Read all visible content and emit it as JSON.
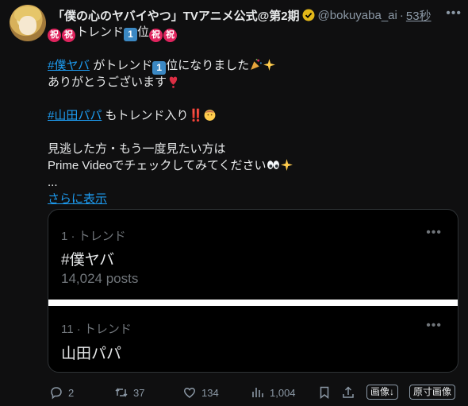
{
  "author": {
    "display_name": "「僕の心のヤバイやつ」TVアニメ公式@第2期",
    "handle": "@bokuyaba_ai",
    "separator": "·",
    "time": "53秒"
  },
  "tweet": {
    "line1_text": "トレンド",
    "line1_suffix": "位",
    "hashtag1": "#僕ヤバ",
    "line3_text": " がトレンド",
    "line3_suffix": "位になりました",
    "line4_text": "ありがとうございます",
    "hashtag2": "#山田パパ",
    "line6_text": " もトレンド入り‼️",
    "line8_text": "見逃した方・もう一度見たい方は",
    "line9_text": "Prime Videoでチェックしてみてください",
    "ellipsis": "...",
    "show_more": "さらに表示",
    "kanji_badge": "祝",
    "keycap": "1"
  },
  "trends": [
    {
      "meta": "1 · トレンド",
      "name": "#僕ヤバ",
      "posts": "14,024 posts"
    },
    {
      "meta": "11 · トレンド",
      "name": "山田パパ"
    }
  ],
  "more_glyph": "•••",
  "actions": {
    "replies": "2",
    "retweets": "37",
    "likes": "134",
    "views": "1,004",
    "image_button": "画像↓",
    "original_size_button": "原寸画像"
  },
  "colors": {
    "link": "#1d9bf0",
    "background": "#0f0f10",
    "muted": "#8b98a5"
  },
  "icons": [
    "verified-badge-icon",
    "celebration-icon",
    "sparkles-icon",
    "heart-exclamation-icon",
    "baby-face-icon",
    "eyes-icon",
    "reply-icon",
    "retweet-icon",
    "like-icon",
    "views-icon",
    "bookmark-icon",
    "share-icon"
  ]
}
